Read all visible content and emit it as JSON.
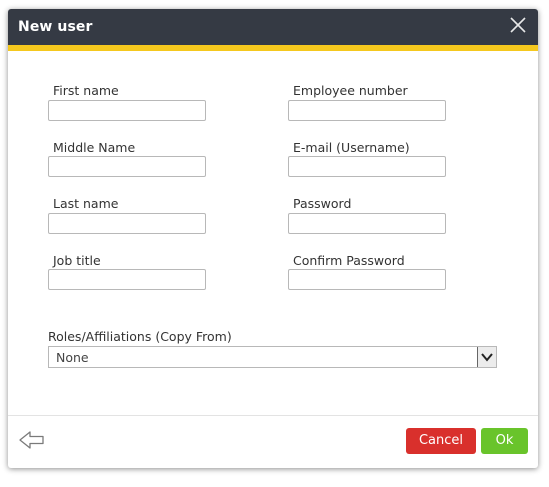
{
  "dialog": {
    "title": "New user",
    "colors": {
      "titlebar": "#353a44",
      "accent_stripe": "#f5c81e",
      "cancel": "#d9302c",
      "ok": "#69c42b"
    }
  },
  "form": {
    "left_column": [
      {
        "label": "First name",
        "value": ""
      },
      {
        "label": "Middle Name",
        "value": ""
      },
      {
        "label": "Last name",
        "value": ""
      },
      {
        "label": "Job title",
        "value": ""
      }
    ],
    "right_column": [
      {
        "label": "Employee number",
        "value": ""
      },
      {
        "label": "E-mail (Username)",
        "value": ""
      },
      {
        "label": "Password",
        "value": ""
      },
      {
        "label": "Confirm Password",
        "value": ""
      }
    ],
    "roles": {
      "label": "Roles/Affiliations (Copy From)",
      "selected": "None"
    }
  },
  "footer": {
    "back_icon": "back-arrow-icon",
    "cancel_label": "Cancel",
    "ok_label": "Ok"
  }
}
